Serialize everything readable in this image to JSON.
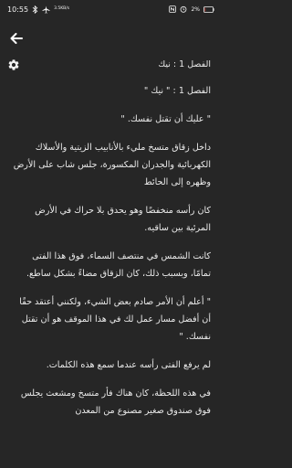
{
  "status_bar": {
    "time": "10:55",
    "network_speed": "3.5KB/s",
    "battery_level": "2%",
    "icons": [
      "bluetooth-icon",
      "airplane-mode-icon",
      "nfc-icon",
      "alarm-clock-icon",
      "battery-icon"
    ]
  },
  "app_bar": {
    "back_icon": "arrow-left-icon"
  },
  "toolbar": {
    "settings_icon": "gear-icon",
    "chapter_title": "الفصل 1 : نيك"
  },
  "reader": {
    "paragraphs": [
      "الفصل 1 : \" نيك \"",
      "\" عليك أن تقتل نفسك. \"",
      "داخل زقاق متسخ مليء بالأنابيب الزيتية والأسلاك الكهربائية والجدران المكسورة، جلس شاب على الأرض وظهره إلى الحائط",
      "كان رأسه منخفضًا وهو يحدق بلا حراك في الأرض المرئية بين ساقيه.",
      "كانت الشمس في منتصف السماء، فوق هذا الفتى تمامًا، وبسبب ذلك، كان الزقاق مضاءً بشكل ساطع.",
      "\" أعلم أن الأمر صادم بعض الشيء، ولكنني أعتقد حقًا أن أفضل مسار عمل لك في هذا الموقف هو أن تقتل نفسك. \"",
      "لم يرفع الفتى رأسه عندما سمع هذه الكلمات.",
      "في هذه اللحظة، كان هناك فأر متسخ ومشعث يجلس فوق صندوق صغير مصنوع من المعدن"
    ]
  },
  "colors": {
    "background": "#262626",
    "text": "#ececec"
  }
}
